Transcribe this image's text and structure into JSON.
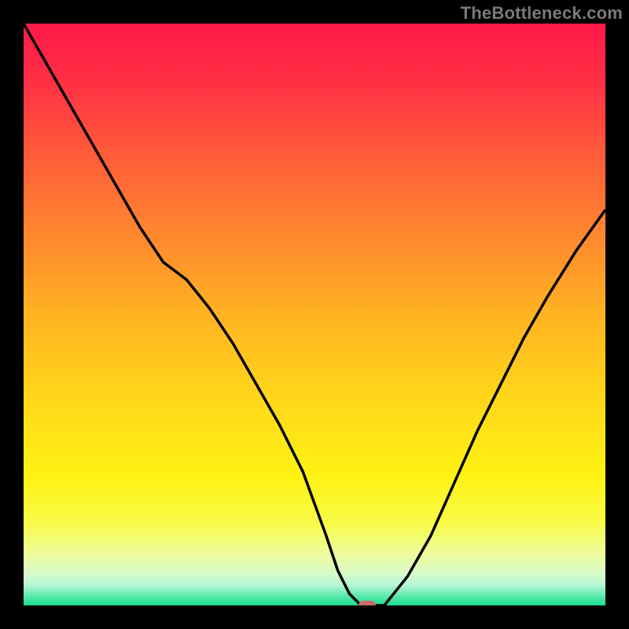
{
  "watermark": "TheBottleneck.com",
  "colors": {
    "marker": "#cc6d6d",
    "curve": "#000000"
  },
  "gradient_stops": [
    {
      "offset": 0.0,
      "color": "#ff1a49"
    },
    {
      "offset": 0.1,
      "color": "#ff2f44"
    },
    {
      "offset": 0.22,
      "color": "#ff5a3a"
    },
    {
      "offset": 0.35,
      "color": "#ff8330"
    },
    {
      "offset": 0.5,
      "color": "#ffb322"
    },
    {
      "offset": 0.65,
      "color": "#ffd81a"
    },
    {
      "offset": 0.78,
      "color": "#fff313"
    },
    {
      "offset": 0.86,
      "color": "#f8fb4a"
    },
    {
      "offset": 0.91,
      "color": "#eefc9a"
    },
    {
      "offset": 0.945,
      "color": "#d9fbc9"
    },
    {
      "offset": 0.965,
      "color": "#b6f7d6"
    },
    {
      "offset": 0.985,
      "color": "#57e8a8"
    },
    {
      "offset": 1.0,
      "color": "#18df8f"
    }
  ],
  "chart_data": {
    "type": "line",
    "title": "",
    "xlabel": "",
    "ylabel": "",
    "xlim": [
      0,
      100
    ],
    "ylim": [
      0,
      100
    ],
    "legend": false,
    "series": [
      {
        "name": "bottleneck-curve",
        "x": [
          0,
          4,
          8,
          12,
          16,
          20,
          24,
          28,
          32,
          36,
          40,
          44,
          48,
          52,
          54,
          56,
          58,
          60,
          62,
          66,
          70,
          74,
          78,
          82,
          86,
          90,
          95,
          100
        ],
        "y": [
          100,
          93,
          86,
          79,
          72,
          65,
          59,
          56,
          51,
          45,
          38,
          31,
          23,
          12,
          6,
          2,
          0,
          0,
          0,
          5,
          12,
          21,
          30,
          38,
          46,
          53,
          61,
          68
        ]
      }
    ],
    "marker": {
      "x": 59,
      "y": 0
    }
  }
}
